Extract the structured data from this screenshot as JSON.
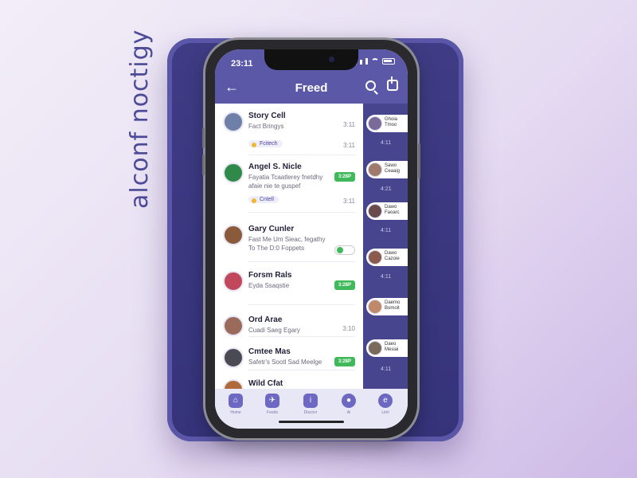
{
  "stand": {
    "side_text": "alconf noctigy"
  },
  "statusbar": {
    "time": "23:11"
  },
  "appbar": {
    "title": "Freed"
  },
  "chats": [
    {
      "name": "Story Cell",
      "sub": "Fact Bringys",
      "meta": "3:11"
    },
    {
      "name": "Angel S. Nicle",
      "sub": "Fayatia Tcaatlerey fnetdhy",
      "sub2": "afaie nie te guspef",
      "pill": "3:28P"
    },
    {
      "name": "Gary Cunler",
      "sub": "Fast Me Um Sieac, fegathy",
      "sub2": "To The D:0 Foppets"
    },
    {
      "name": "Forsm Rals",
      "sub": "Eyda Ssaqstie",
      "pill": "3:28P"
    },
    {
      "name": "Ord Arae",
      "sub": "Cuadi Saeg Egary",
      "meta": "3:10"
    },
    {
      "name": "Cmtee Mas",
      "sub": "Safetr's Sootl Sad Meelge",
      "pill": "3:28P"
    },
    {
      "name": "Wild Cfat",
      "sub": ""
    }
  ],
  "tags": [
    {
      "label": "Fcitech",
      "meta": "3:11"
    },
    {
      "label": "Cntell",
      "meta": "3:11"
    }
  ],
  "side": {
    "cards": [
      {
        "l1": "Ghoia",
        "l2": "Tmoo"
      },
      {
        "l1": "Sawo",
        "l2": "Ceaaig"
      },
      {
        "l1": "Dawo",
        "l2": "Faoarc"
      },
      {
        "l1": "Dawo",
        "l2": "Cazoie"
      },
      {
        "l1": "Daemo",
        "l2": "Bomoit"
      },
      {
        "l1": "Daeo",
        "l2": "Mesiai"
      }
    ],
    "nums": [
      "4:11",
      "4:21",
      "4:11",
      "4:11",
      "4:11"
    ]
  },
  "tabs": [
    {
      "label": "Home",
      "icon": "home-icon"
    },
    {
      "label": "Feeds",
      "icon": "plane-icon"
    },
    {
      "label": "Discovr",
      "icon": "info-icon"
    },
    {
      "label": "Ai",
      "icon": "chat-icon"
    },
    {
      "label": "Liml",
      "icon": "profile-icon"
    }
  ]
}
